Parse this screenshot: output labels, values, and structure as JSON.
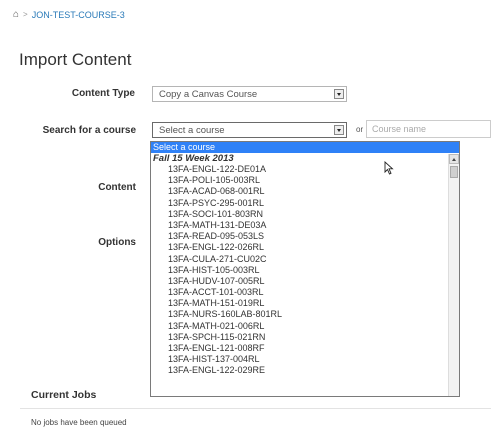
{
  "breadcrumb": {
    "course": "JON-TEST-COURSE-3"
  },
  "page": {
    "title": "Import Content"
  },
  "form": {
    "content_type_label": "Content Type",
    "content_type_value": "Copy a Canvas Course",
    "search_label": "Search for a course",
    "search_value": "Select a course",
    "or_label": "or",
    "course_name_placeholder": "Course name",
    "content_label": "Content",
    "options_label": "Options"
  },
  "dropdown": {
    "selected": "Select a course",
    "group": "Fall 15 Week 2013",
    "options": [
      "13FA-ENGL-122-DE01A",
      "13FA-POLI-105-003RL",
      "13FA-ACAD-068-001RL",
      "13FA-PSYC-295-001RL",
      "13FA-SOCI-101-803RN",
      "13FA-MATH-131-DE03A",
      "13FA-READ-095-053LS",
      "13FA-ENGL-122-026RL",
      "13FA-CULA-271-CU02C",
      "13FA-HIST-105-003RL",
      "13FA-HUDV-107-005RL",
      "13FA-ACCT-101-003RL",
      "13FA-MATH-151-019RL",
      "13FA-NURS-160LAB-801RL",
      "13FA-MATH-021-006RL",
      "13FA-SPCH-115-021RN",
      "13FA-ENGL-121-008RF",
      "13FA-HIST-137-004RL",
      "13FA-ENGL-122-029RE"
    ]
  },
  "jobs": {
    "title": "Current Jobs",
    "empty_text": "No jobs have been queued"
  },
  "colors": {
    "link": "#2a7ab8",
    "highlight": "#2f81f7"
  }
}
